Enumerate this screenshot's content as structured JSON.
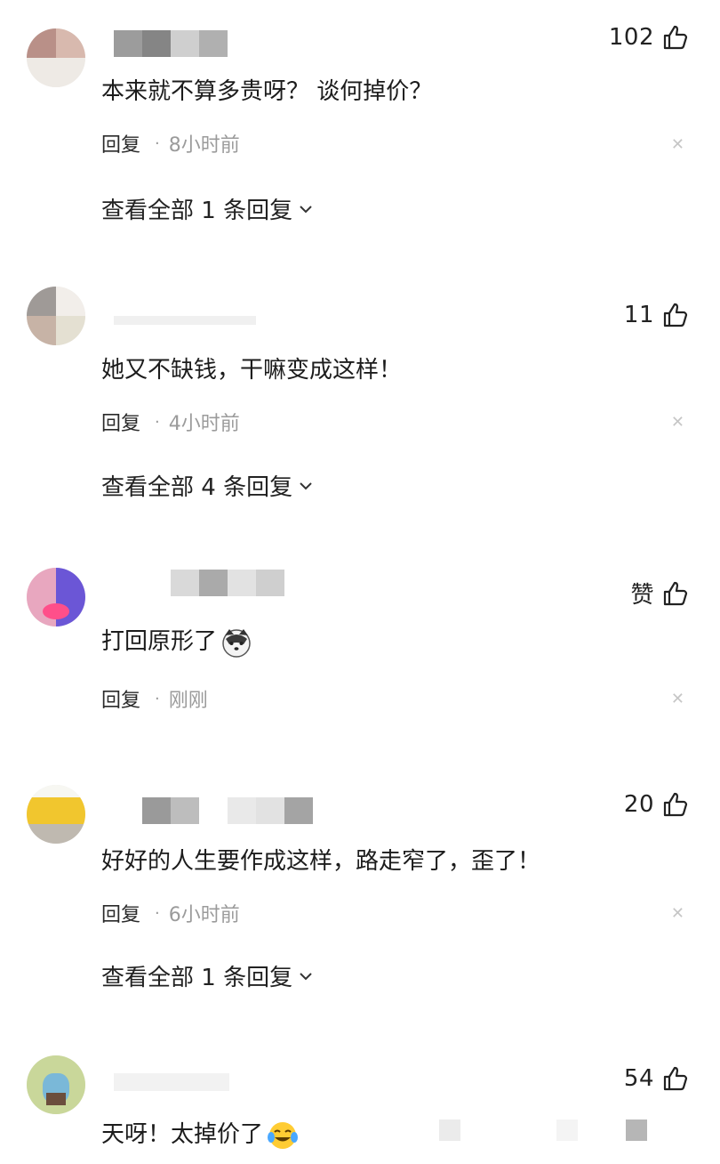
{
  "comments": [
    {
      "likes": "102",
      "text": "本来就不算多贵呀？ 谈何掉价？",
      "reply_label": "回复",
      "separator": "·",
      "time": "8小时前",
      "view_all": "查看全部 1 条回复"
    },
    {
      "likes": "11",
      "text": "她又不缺钱，干嘛变成这样！",
      "reply_label": "回复",
      "separator": "·",
      "time": "4小时前",
      "view_all": "查看全部 4 条回复"
    },
    {
      "likes": "赞",
      "text": "打回原形了",
      "reply_label": "回复",
      "separator": "·",
      "time": "刚刚",
      "emoji": "husky-dog-emoji"
    },
    {
      "likes": "20",
      "text": "好好的人生要作成这样，路走窄了，歪了！",
      "reply_label": "回复",
      "separator": "·",
      "time": "6小时前",
      "view_all": "查看全部 1 条回复"
    },
    {
      "likes": "54",
      "text": "天呀！太掉价了",
      "emoji": "crying-laughing-emoji"
    }
  ],
  "icons": {
    "like": "thumbs-up-icon",
    "close": "close-icon",
    "expand": "chevron-down-icon"
  },
  "colors": {
    "text": "#1c1c1c",
    "secondary": "#9b9b9b",
    "close": "#c6c6c6"
  }
}
